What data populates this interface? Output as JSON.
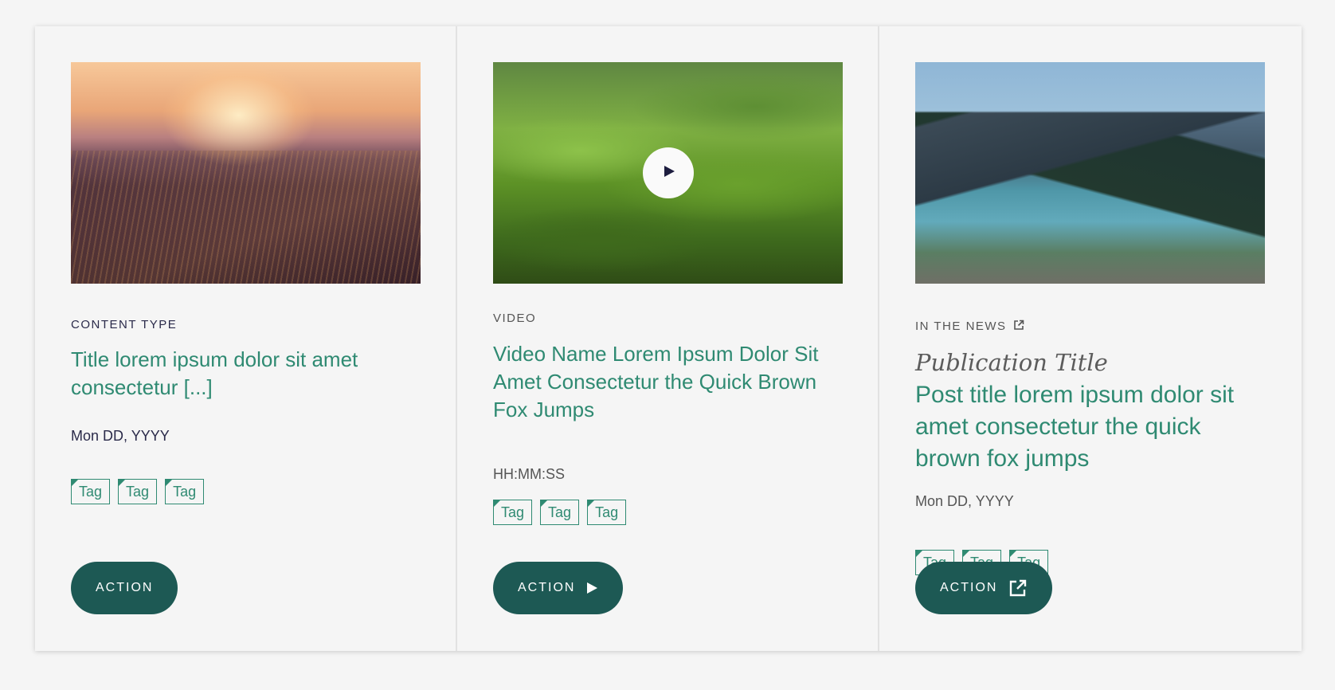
{
  "colors": {
    "accent": "#2f8a72",
    "button_bg": "#1d5954",
    "page_bg": "#f5f5f5",
    "eyebrow": "#2a2a4a"
  },
  "cards": [
    {
      "eyebrow": "CONTENT TYPE",
      "title": "Title lorem ipsum dolor sit amet consectetur [...]",
      "date": "Mon DD, YYYY",
      "tags": [
        "Tag",
        "Tag",
        "Tag"
      ],
      "action_label": "ACTION",
      "image": "sunset-landscape"
    },
    {
      "eyebrow": "VIDEO",
      "title": "Video Name Lorem Ipsum Dolor Sit Amet Consectetur the Quick Brown Fox Jumps",
      "duration": "HH:MM:SS",
      "tags": [
        "Tag",
        "Tag",
        "Tag"
      ],
      "action_label": "ACTION",
      "action_icon": "play-icon",
      "image": "green-hills"
    },
    {
      "eyebrow": "IN THE NEWS",
      "eyebrow_icon": "external-link-icon",
      "publication": "Publication Title",
      "title": "Post title lorem ipsum dolor sit amet consectetur the quick brown fox jumps",
      "date": "Mon DD, YYYY",
      "tags": [
        "Tag",
        "Tag",
        "Tag"
      ],
      "action_label": "ACTION",
      "action_icon": "external-link-icon",
      "image": "mountain-lake"
    }
  ]
}
